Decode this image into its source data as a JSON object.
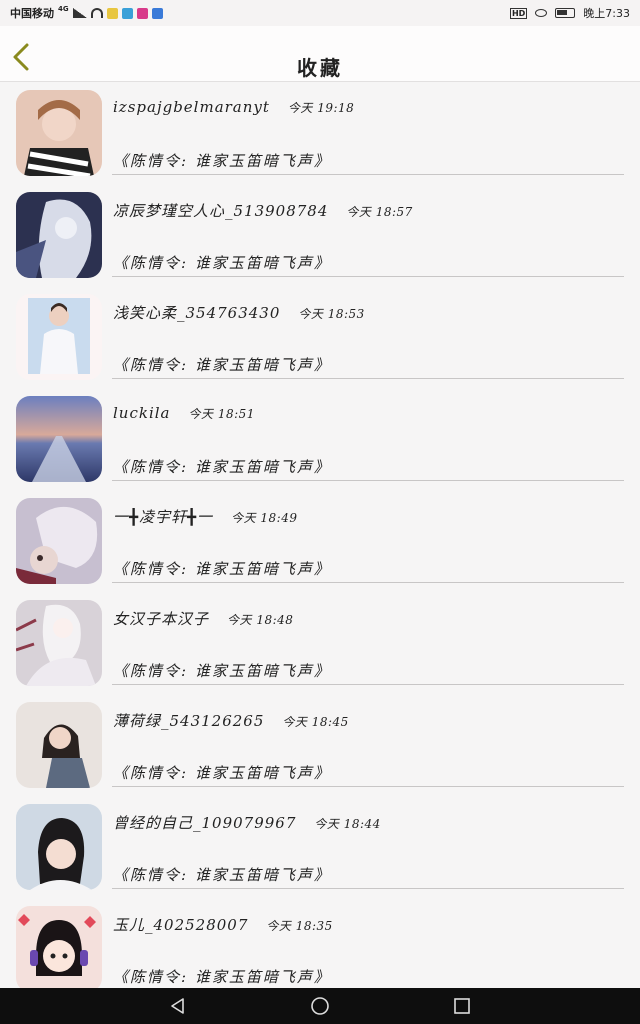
{
  "status": {
    "carrier": "中国移动",
    "network": "4G",
    "time": "晚上7:33",
    "hd_label": "HD"
  },
  "header": {
    "title": "收藏"
  },
  "items": [
    {
      "name": "izspajgbelmaranyt",
      "time": "今天 19:18",
      "subtitle": "《陈情令: 谁家玉笛暗飞声》",
      "avatar_bg": "#e6c7b7"
    },
    {
      "name": "凉辰梦瑾空人心_513908784",
      "time": "今天 18:57",
      "subtitle": "《陈情令: 谁家玉笛暗飞声》",
      "avatar_bg": "#2c3150"
    },
    {
      "name": "浅笑心柔_354763430",
      "time": "今天 18:53",
      "subtitle": "《陈情令: 谁家玉笛暗飞声》",
      "avatar_bg": "#c9dbee"
    },
    {
      "name": "luckila",
      "time": "今天 18:51",
      "subtitle": "《陈情令: 谁家玉笛暗飞声》",
      "avatar_bg": "#5a6aa0"
    },
    {
      "name": "一╋凌宇轩╋一",
      "time": "今天 18:49",
      "subtitle": "《陈情令: 谁家玉笛暗飞声》",
      "avatar_bg": "#c7bfd0"
    },
    {
      "name": "女汉子本汉子",
      "time": "今天 18:48",
      "subtitle": "《陈情令: 谁家玉笛暗飞声》",
      "avatar_bg": "#d8d2d8"
    },
    {
      "name": "薄荷绿_543126265",
      "time": "今天 18:45",
      "subtitle": "《陈情令: 谁家玉笛暗飞声》",
      "avatar_bg": "#e9e3df"
    },
    {
      "name": "曾经的自己_109079967",
      "time": "今天 18:44",
      "subtitle": "《陈情令: 谁家玉笛暗飞声》",
      "avatar_bg": "#cfd9e4"
    },
    {
      "name": "玉儿_402528007",
      "time": "今天 18:35",
      "subtitle": "《陈情令: 谁家玉笛暗飞声》",
      "avatar_bg": "#f4e0dc"
    }
  ],
  "colors": {
    "back_arrow": "#8a8a1e",
    "background": "#f6f5f5",
    "nav_bar": "#0e0e0e"
  },
  "icons": {
    "back": "chevron-left-icon",
    "nav_back": "triangle-back-icon",
    "nav_home": "circle-home-icon",
    "nav_recent": "square-recent-icon"
  }
}
